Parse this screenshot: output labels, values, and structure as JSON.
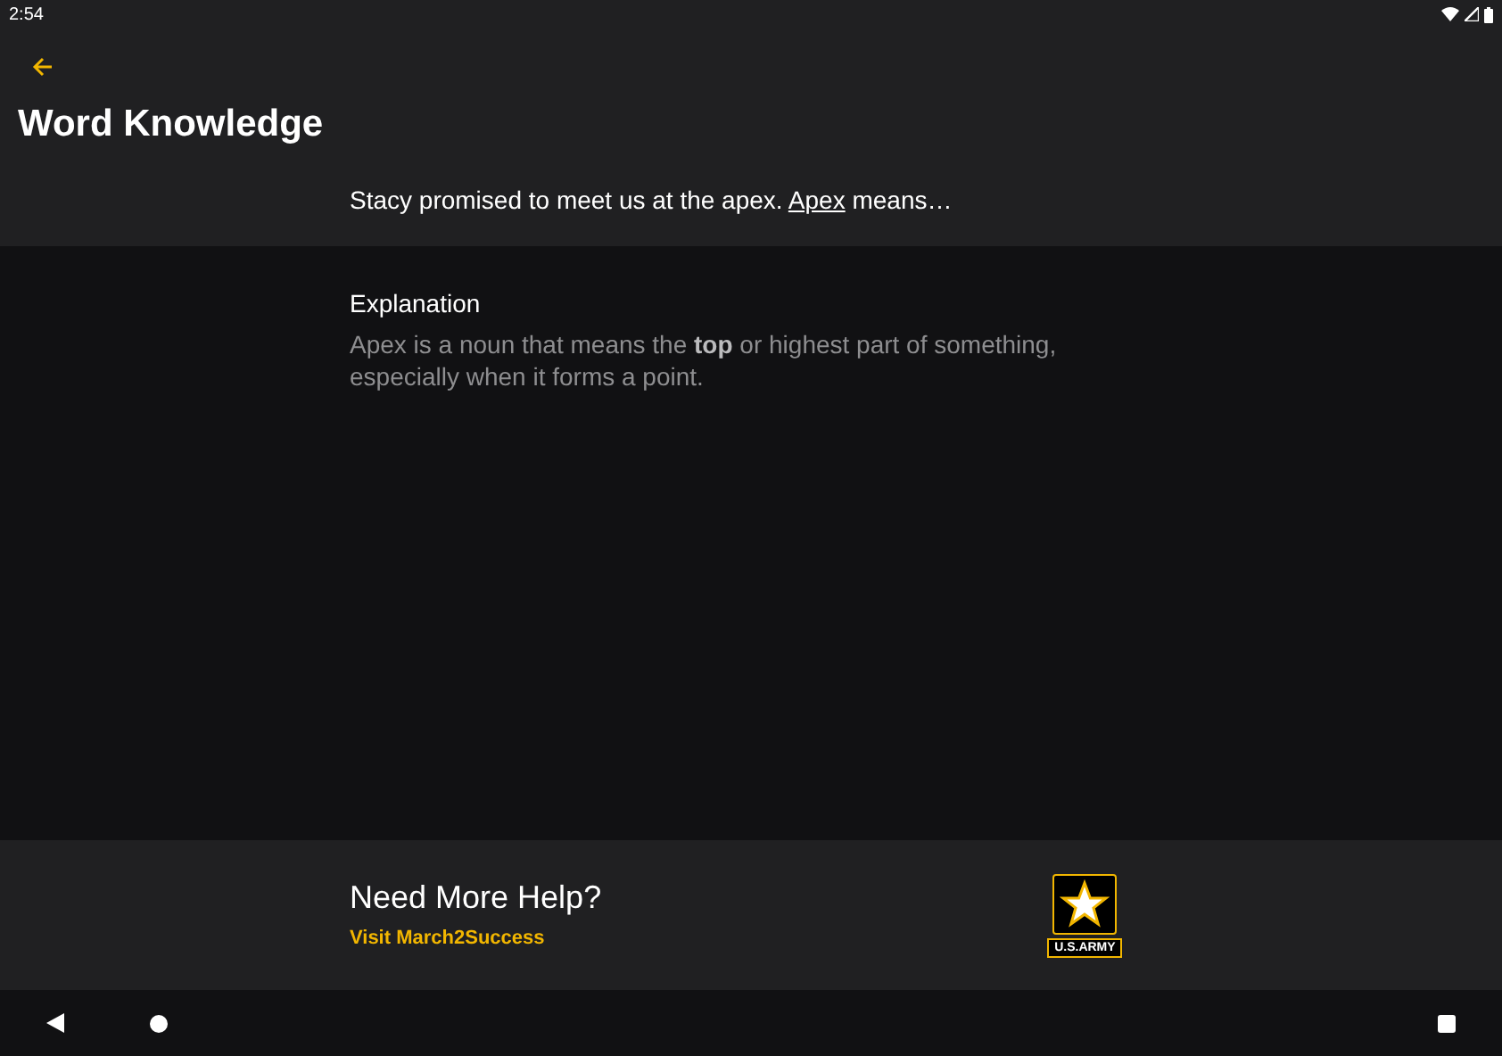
{
  "status_bar": {
    "time": "2:54"
  },
  "header": {
    "title": "Word Knowledge"
  },
  "question": {
    "before": "Stacy promised to meet us at the apex. ",
    "term": "Apex",
    "after": " means…"
  },
  "explanation": {
    "heading": "Explanation",
    "text": "Apex is a noun that means the **top** or highest part of something, especially when it forms a point."
  },
  "footer": {
    "heading": "Need More Help?",
    "link": "Visit March2Success",
    "logo_text": "U.S.ARMY"
  }
}
